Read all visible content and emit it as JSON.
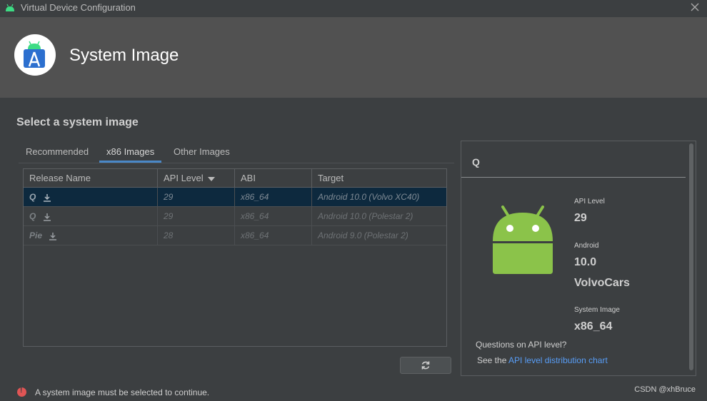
{
  "window": {
    "title": "Virtual Device Configuration"
  },
  "header": {
    "title": "System Image"
  },
  "section": {
    "title": "Select a system image"
  },
  "tabs": [
    {
      "label": "Recommended",
      "active": false
    },
    {
      "label": "x86 Images",
      "active": true
    },
    {
      "label": "Other Images",
      "active": false
    }
  ],
  "table": {
    "columns": [
      "Release Name",
      "API Level",
      "ABI",
      "Target"
    ],
    "sort_column": "API Level",
    "rows": [
      {
        "release": "Q",
        "api": "29",
        "abi": "x86_64",
        "target": "Android 10.0 (Volvo XC40)",
        "selected": true
      },
      {
        "release": "Q",
        "api": "29",
        "abi": "x86_64",
        "target": "Android 10.0 (Polestar 2)",
        "selected": false
      },
      {
        "release": "Pie",
        "api": "28",
        "abi": "x86_64",
        "target": "Android 9.0 (Polestar 2)",
        "selected": false
      }
    ]
  },
  "detail": {
    "title": "Q",
    "api_label": "API Level",
    "api_value": "29",
    "android_label": "Android",
    "android_version": "10.0",
    "vendor": "VolvoCars",
    "system_image_label": "System Image",
    "system_image_value": "x86_64",
    "question": "Questions on API level?",
    "see_prefix": "See the ",
    "link": "API level distribution chart"
  },
  "error": {
    "message": "A system image must be selected to continue."
  },
  "watermark": "CSDN @xhBruce",
  "colors": {
    "accent": "#4a88c7",
    "selected_row": "#0d293e",
    "link": "#589df6",
    "error": "#e05555",
    "android_green": "#8bc34a"
  }
}
